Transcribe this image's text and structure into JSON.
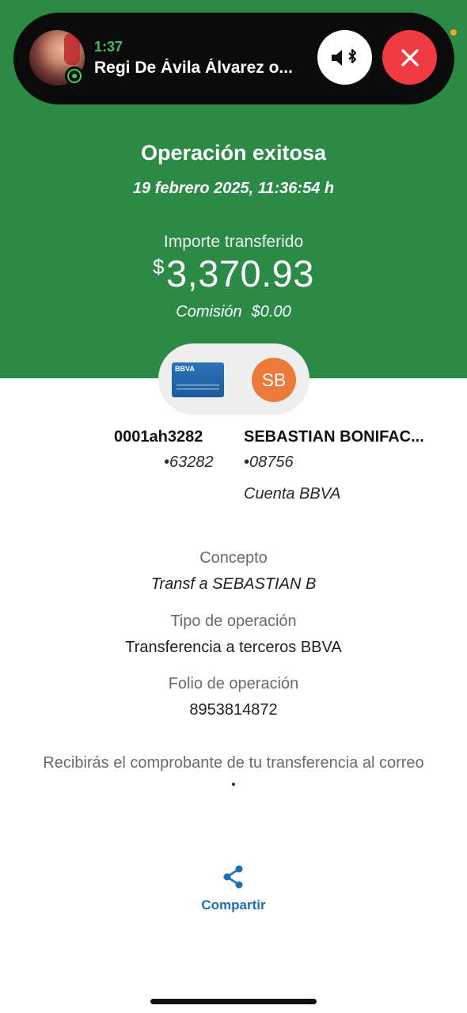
{
  "call": {
    "time": "1:37",
    "caller": "Regi De Ávila Álvarez o...",
    "app_icon": "whatsapp-icon",
    "audio_icon": "speaker-bluetooth-icon",
    "end_icon": "close-icon"
  },
  "receipt": {
    "title": "Operación exitosa",
    "datetime": "19 febrero 2025, 11:36:54 h",
    "amount_label": "Importe transferido",
    "currency_symbol": "$",
    "amount": "3,370.93",
    "commission_label": "Comisión",
    "commission_value": "$0.00"
  },
  "transfer": {
    "card_brand": "BBVA",
    "recipient_initials": "SB",
    "from": {
      "name": "0001ah3282",
      "account": "•63282"
    },
    "to": {
      "name": "SEBASTIAN BONIFAC...",
      "account": "•08756",
      "bank": "Cuenta BBVA"
    }
  },
  "details": [
    {
      "label": "Concepto",
      "value": "Transf a SEBASTIAN B"
    },
    {
      "label": "Tipo de operación",
      "value": "Transferencia a terceros BBVA"
    },
    {
      "label": "Folio de operación",
      "value": "8953814872"
    }
  ],
  "notice": "Recibirás el comprobante de tu transferencia al correo",
  "share": {
    "label": "Compartir",
    "icon": "share-icon"
  },
  "colors": {
    "header_green": "#2c8a47",
    "end_call_red": "#f03b43",
    "avatar_orange": "#ec7a3a",
    "link_blue": "#1a6fb5"
  }
}
